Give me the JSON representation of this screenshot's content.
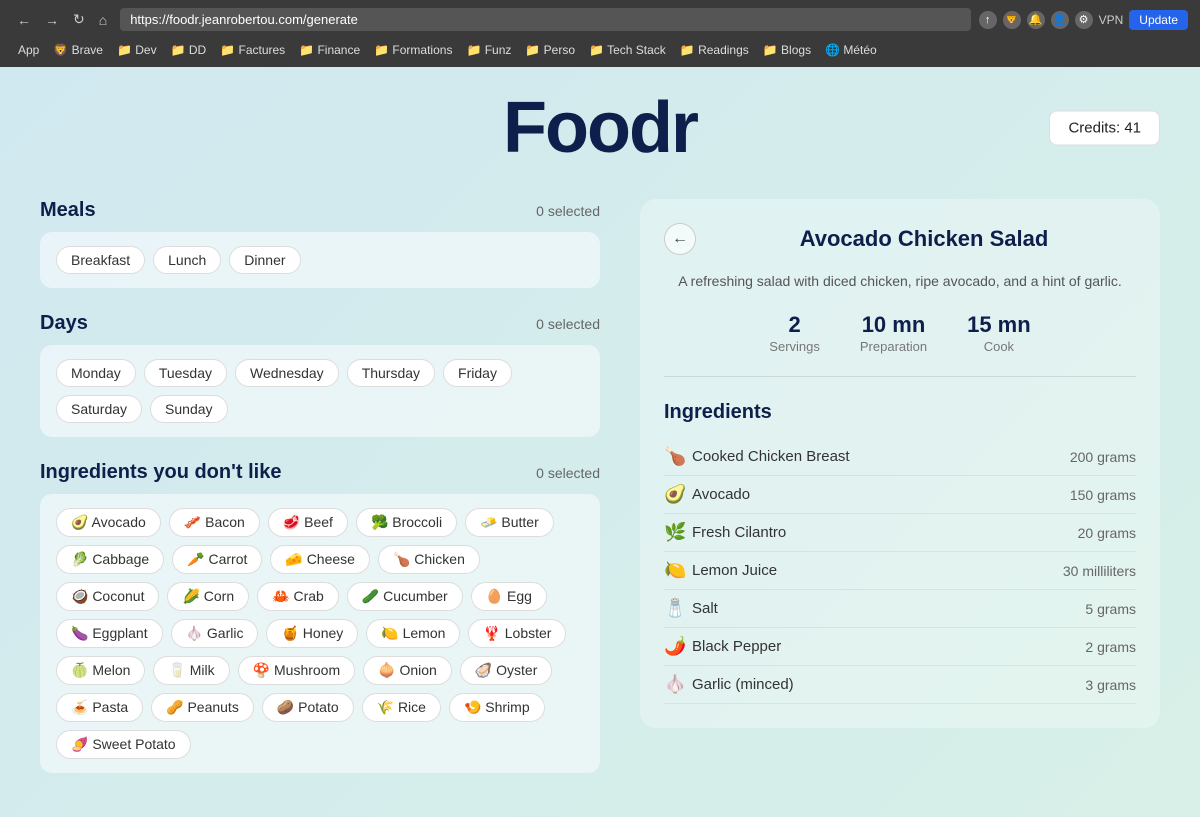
{
  "browser": {
    "url": "https://foodr.jeanrobertou.com/generate",
    "bookmarks": [
      "App",
      "Brave",
      "Dev",
      "DD",
      "Factures",
      "Finance",
      "Formations",
      "Funz",
      "Perso",
      "Tech Stack",
      "Readings",
      "Blogs",
      "Météo"
    ],
    "update_label": "Update"
  },
  "header": {
    "title": "Foodr",
    "credits_label": "Credits:",
    "credits_value": "41"
  },
  "meals": {
    "title": "Meals",
    "count_label": "0 selected",
    "options": [
      {
        "label": "Breakfast"
      },
      {
        "label": "Lunch"
      },
      {
        "label": "Dinner"
      }
    ]
  },
  "days": {
    "title": "Days",
    "count_label": "0 selected",
    "options": [
      {
        "label": "Monday"
      },
      {
        "label": "Tuesday"
      },
      {
        "label": "Wednesday"
      },
      {
        "label": "Thursday"
      },
      {
        "label": "Friday"
      },
      {
        "label": "Saturday"
      },
      {
        "label": "Sunday"
      }
    ]
  },
  "ingredients_dislike": {
    "title": "Ingredients you don't like",
    "count_label": "0 selected",
    "options": [
      {
        "emoji": "🥑",
        "label": "Avocado"
      },
      {
        "emoji": "🥓",
        "label": "Bacon"
      },
      {
        "emoji": "🥩",
        "label": "Beef"
      },
      {
        "emoji": "🥦",
        "label": "Broccoli"
      },
      {
        "emoji": "🧈",
        "label": "Butter"
      },
      {
        "emoji": "🥬",
        "label": "Cabbage"
      },
      {
        "emoji": "🥕",
        "label": "Carrot"
      },
      {
        "emoji": "🧀",
        "label": "Cheese"
      },
      {
        "emoji": "🍗",
        "label": "Chicken"
      },
      {
        "emoji": "🥥",
        "label": "Coconut"
      },
      {
        "emoji": "🌽",
        "label": "Corn"
      },
      {
        "emoji": "🦀",
        "label": "Crab"
      },
      {
        "emoji": "🥒",
        "label": "Cucumber"
      },
      {
        "emoji": "🥚",
        "label": "Egg"
      },
      {
        "emoji": "🍆",
        "label": "Eggplant"
      },
      {
        "emoji": "🧄",
        "label": "Garlic"
      },
      {
        "emoji": "🍯",
        "label": "Honey"
      },
      {
        "emoji": "🍋",
        "label": "Lemon"
      },
      {
        "emoji": "🦞",
        "label": "Lobster"
      },
      {
        "emoji": "🍈",
        "label": "Melon"
      },
      {
        "emoji": "🥛",
        "label": "Milk"
      },
      {
        "emoji": "🍄",
        "label": "Mushroom"
      },
      {
        "emoji": "🧅",
        "label": "Onion"
      },
      {
        "emoji": "🦪",
        "label": "Oyster"
      },
      {
        "emoji": "🍝",
        "label": "Pasta"
      },
      {
        "emoji": "🥜",
        "label": "Peanuts"
      },
      {
        "emoji": "🥔",
        "label": "Potato"
      },
      {
        "emoji": "🌾",
        "label": "Rice"
      },
      {
        "emoji": "🍤",
        "label": "Shrimp"
      },
      {
        "emoji": "🍠",
        "label": "Sweet Potato"
      }
    ]
  },
  "recipe": {
    "title": "Avocado Chicken Salad",
    "description": "A refreshing salad with diced chicken, ripe avocado, and a hint of garlic.",
    "servings_label": "Servings",
    "servings_value": "2",
    "prep_label": "Preparation",
    "prep_value": "10 mn",
    "cook_label": "Cook",
    "cook_value": "15 mn",
    "ingredients_title": "Ingredients",
    "ingredients": [
      {
        "emoji": "🍗",
        "name": "Cooked Chicken Breast",
        "amount": "200 grams"
      },
      {
        "emoji": "🥑",
        "name": "Avocado",
        "amount": "150 grams"
      },
      {
        "emoji": "🌿",
        "name": "Fresh Cilantro",
        "amount": "20 grams"
      },
      {
        "emoji": "🍋",
        "name": "Lemon Juice",
        "amount": "30 milliliters"
      },
      {
        "emoji": "🧂",
        "name": "Salt",
        "amount": "5 grams"
      },
      {
        "emoji": "🌶️",
        "name": "Black Pepper",
        "amount": "2 grams"
      },
      {
        "emoji": "🧄",
        "name": "Garlic (minced)",
        "amount": "3 grams"
      }
    ]
  }
}
